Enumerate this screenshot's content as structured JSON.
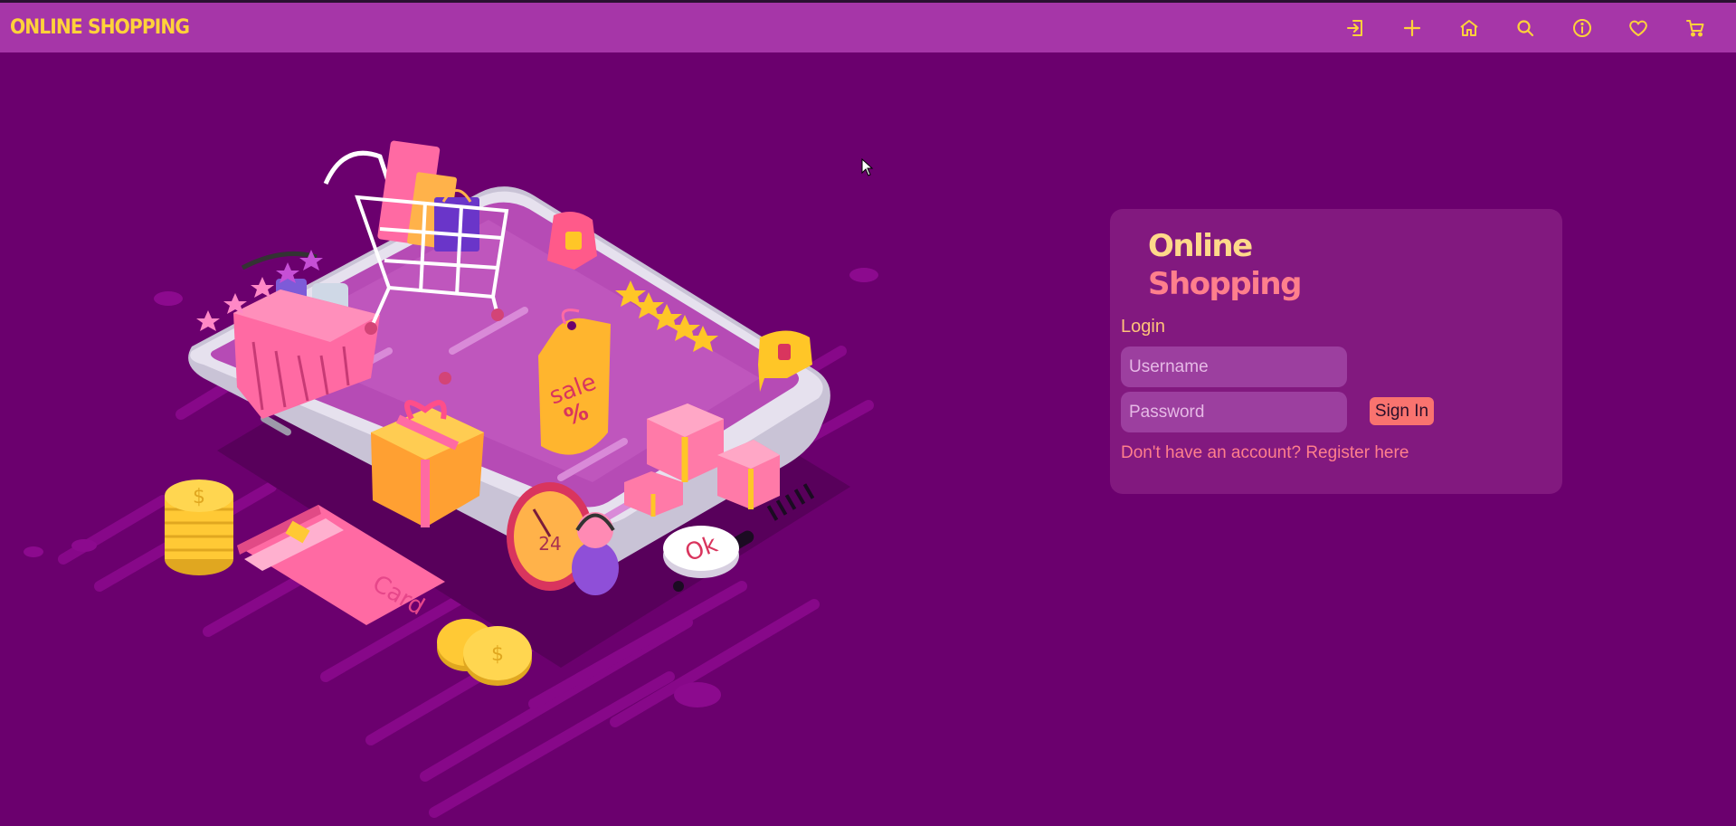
{
  "navbar": {
    "brand": "ONLINE SHOPPING",
    "icons": [
      {
        "name": "login-icon"
      },
      {
        "name": "plus-icon"
      },
      {
        "name": "home-icon"
      },
      {
        "name": "search-icon"
      },
      {
        "name": "info-icon"
      },
      {
        "name": "heart-icon"
      },
      {
        "name": "cart-icon"
      }
    ]
  },
  "illustration": {
    "sale_tag_text": "sale",
    "sale_tag_symbol": "%",
    "clock_text": "24",
    "ok_text": "Ok",
    "card_text": "Card",
    "coin_symbol": "$"
  },
  "login": {
    "logo_line1": "Online",
    "logo_line2": "Shopping",
    "heading": "Login",
    "username_placeholder": "Username",
    "password_placeholder": "Password",
    "signin_label": "Sign In",
    "register_link": "Don't have an account? Register here"
  },
  "colors": {
    "background": "#6b006e",
    "navbar": "#a636a8",
    "brand": "#ffd23a",
    "card": "#82197f",
    "accent": "#f9736f"
  }
}
